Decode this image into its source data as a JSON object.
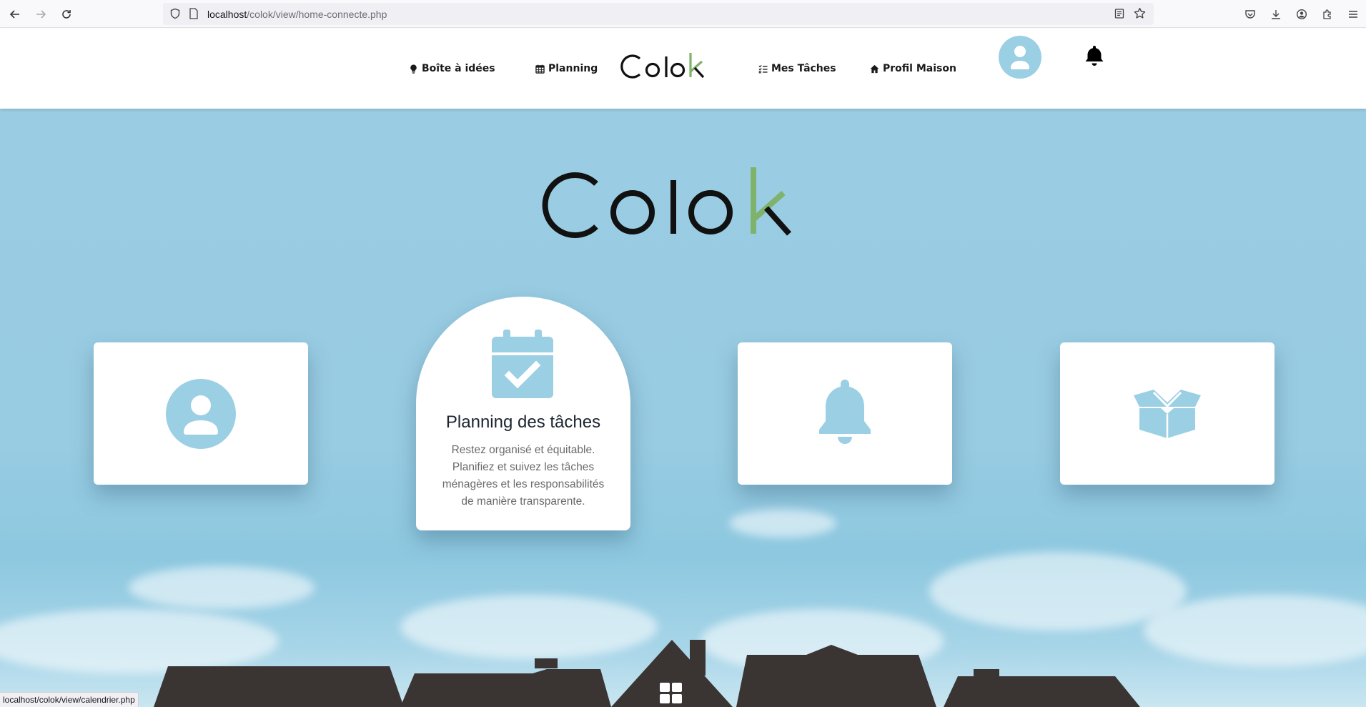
{
  "browser": {
    "url_host": "localhost",
    "url_path": "/colok/view/home-connecte.php"
  },
  "header": {
    "nav": [
      {
        "label": "Boîte à idées",
        "icon": "lightbulb-icon"
      },
      {
        "label": "Planning",
        "icon": "calendar-icon"
      },
      {
        "label": "Mes Tâches",
        "icon": "tasks-list-icon"
      },
      {
        "label": "Profil Maison",
        "icon": "home-icon"
      }
    ],
    "logo": "Colok"
  },
  "hero": {
    "logo": "Colok",
    "cards": [
      {
        "icon": "user-circle-icon"
      },
      {
        "icon": "calendar-check-icon",
        "title": "Planning des tâches",
        "description": "Restez organisé et équitable. Planifiez et suivez les tâches ménagères et les responsabilités de manière transparente."
      },
      {
        "icon": "bell-icon"
      },
      {
        "icon": "open-box-icon"
      }
    ]
  },
  "status_bar": {
    "url": "localhost/colok/view/calendrier.php"
  },
  "colors": {
    "accent_blue": "#9bcfe4",
    "logo_green": "#7fb26a",
    "rooftop": "#3a3433"
  }
}
